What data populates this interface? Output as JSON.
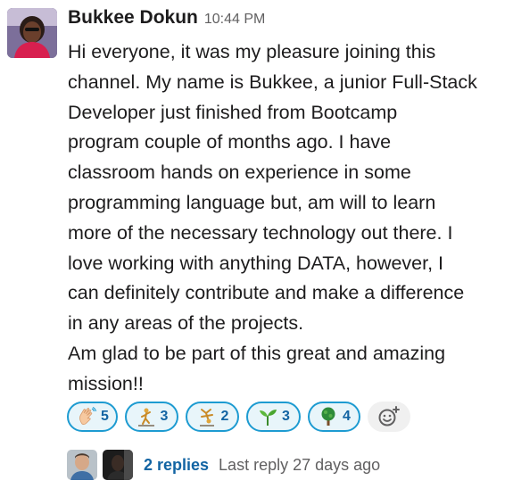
{
  "message": {
    "author": "Bukkee Dokun",
    "timestamp": "10:44 PM",
    "lines": [
      "Hi everyone, it was my pleasure joining this",
      "channel. My name is Bukkee, a junior Full-Stack",
      "Developer just finished from Bootcamp",
      "program couple of months ago. I have",
      "classroom hands on experience in some",
      "programming language but, am will to learn",
      "more of the necessary technology out there. I",
      "love working with anything DATA, however, I",
      "can definitely contribute and make a difference",
      "in any areas of the projects.",
      "Am glad to be part of this great and amazing",
      "mission!!"
    ]
  },
  "reactions": [
    {
      "icon": "waving-hand-icon",
      "count": "5"
    },
    {
      "icon": "person-climbing-icon",
      "count": "3"
    },
    {
      "icon": "person-cartwheeling-icon",
      "count": "2"
    },
    {
      "icon": "seedling-icon",
      "count": "3"
    },
    {
      "icon": "tree-icon",
      "count": "4"
    }
  ],
  "add_reaction": {
    "icon": "add-reaction-icon"
  },
  "thread": {
    "replies": "2 replies",
    "last_reply": "Last reply 27 days ago"
  },
  "colors": {
    "reaction_border": "#1d9bd1",
    "reaction_bg": "#e8f5fa",
    "link": "#1264a3",
    "muted": "#616061"
  }
}
